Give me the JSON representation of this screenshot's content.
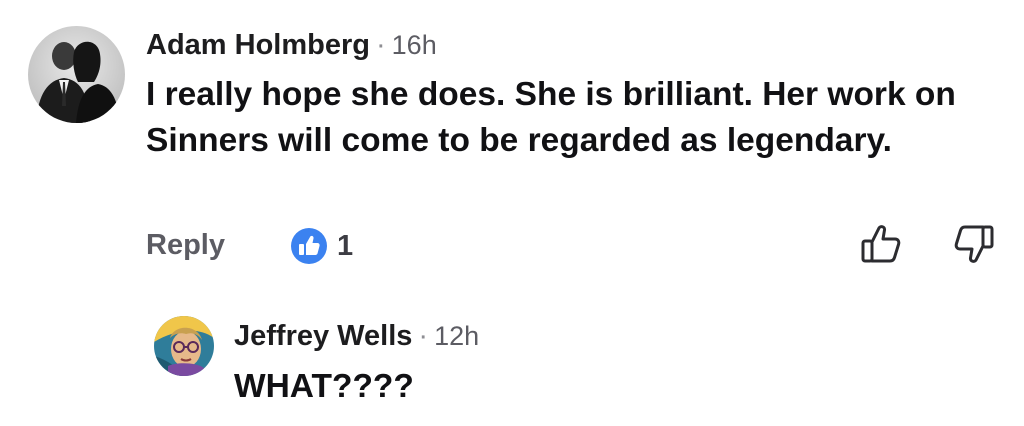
{
  "comment": {
    "author": "Adam Holmberg",
    "separator": "·",
    "time": "16h",
    "text": "I really hope she does. She is brilliant. Her work on Sinners will come to be regarded as legendary.",
    "reply_label": "Reply",
    "like_count": "1",
    "avatar_icon": "avatar-photo",
    "like_badge_icon": "thumbs-up-badge-icon",
    "like_badge_color": "#3b82f0"
  },
  "reply": {
    "author": "Jeffrey Wells",
    "separator": "·",
    "time": "12h",
    "text": "WHAT????",
    "avatar_icon": "avatar-illustration"
  },
  "actions": {
    "thumbs_up_icon": "thumbs-up-icon",
    "thumbs_down_icon": "thumbs-down-icon"
  }
}
